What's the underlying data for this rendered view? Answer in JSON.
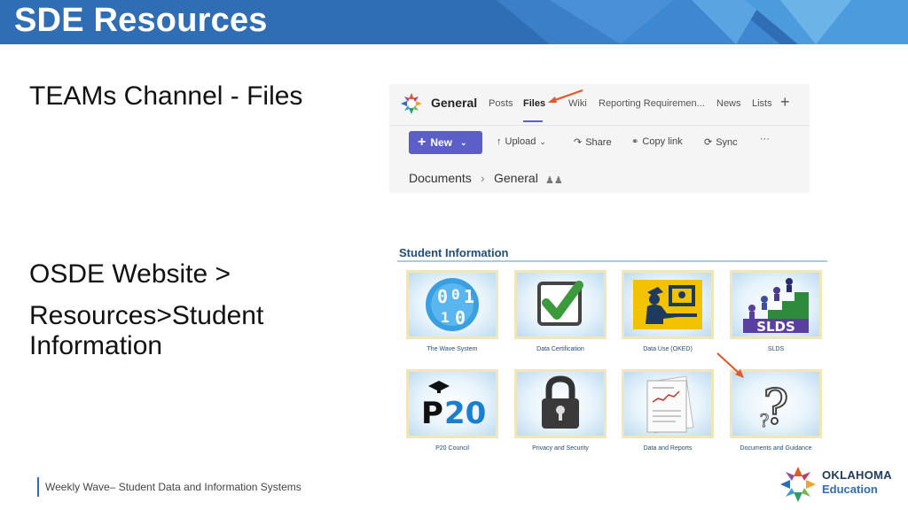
{
  "slide": {
    "title": "SDE Resources",
    "section1": "TEAMs Channel - Files",
    "section2_line1": "OSDE Website >",
    "section2_line2": "Resources>Student",
    "section2_line3": "Information",
    "footer": "Weekly Wave– Student Data and Information Systems"
  },
  "teams": {
    "channel": "General",
    "tabs": [
      "Posts",
      "Files",
      "Wiki",
      "Reporting Requiremen...",
      "News",
      "Lists"
    ],
    "active_tab": "Files",
    "toolbar": {
      "new_label": "New",
      "upload_label": "Upload",
      "share_label": "Share",
      "copy_link_label": "Copy link",
      "sync_label": "Sync",
      "more_label": "···"
    },
    "breadcrumb": [
      "Documents",
      "General"
    ],
    "accent_color": "#5b5fc7"
  },
  "student_info": {
    "heading": "Student Information",
    "tiles": [
      {
        "caption": "The Wave System",
        "icon": "binary-data-icon"
      },
      {
        "caption": "Data Certification",
        "icon": "checkmark-icon"
      },
      {
        "caption": "Data Use (OKED)",
        "icon": "person-at-computer-icon"
      },
      {
        "caption": "SLDS",
        "icon": "slds-growth-icon"
      },
      {
        "caption": "P20 Council",
        "icon": "p20-graduation-icon"
      },
      {
        "caption": "Privacy and Security",
        "icon": "padlock-icon"
      },
      {
        "caption": "Data and Reports",
        "icon": "report-document-icon"
      },
      {
        "caption": "Documents and Guidance",
        "icon": "question-mark-icon"
      }
    ],
    "p20_text": "P20",
    "slds_text": "SLDS"
  },
  "brand": {
    "logo_line1": "OKLAHOMA",
    "logo_line2": "Education",
    "header_color": "#2f6db5"
  }
}
